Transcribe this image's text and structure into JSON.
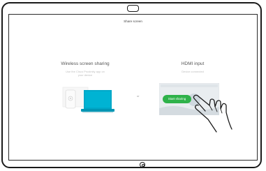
{
  "screen": {
    "title": "Share screen"
  },
  "wireless": {
    "title": "Wireless screen sharing",
    "subtitle_line1": "Use the Cisco Proximity app on",
    "subtitle_line2": "your device"
  },
  "separator": {
    "label": "or"
  },
  "hdmi": {
    "title": "HDMI input",
    "subtitle": "Device connected",
    "start_button_label": "Start sharing"
  },
  "colors": {
    "accent_green": "#2fb24a",
    "laptop_teal": "#00a8c8",
    "bezel": "#1a1a1a"
  },
  "icons": {
    "camera": "camera-icon",
    "home": "home-button-icon",
    "phone": "phone-icon",
    "laptop": "laptop-icon",
    "hand": "hand-pointer-icon"
  }
}
